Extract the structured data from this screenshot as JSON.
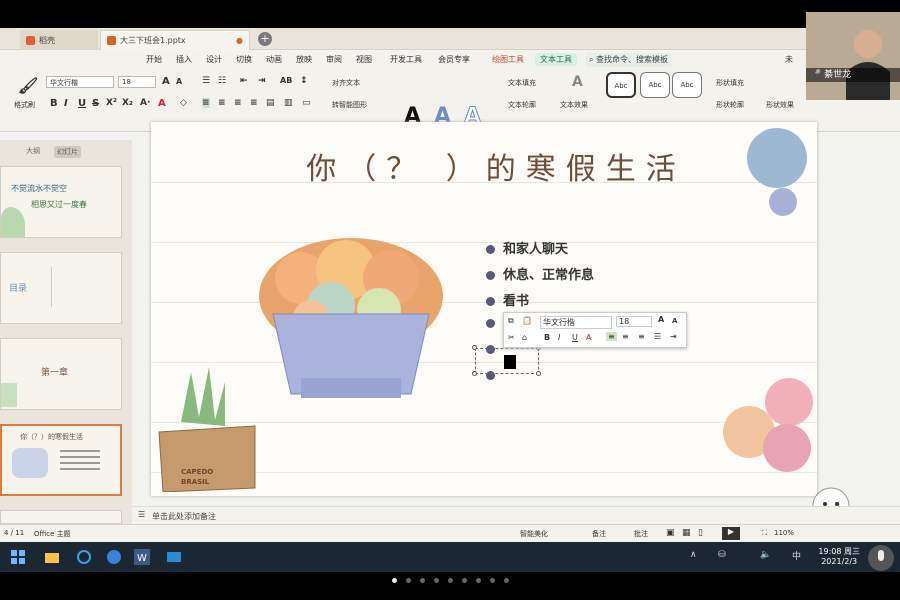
{
  "tabs": {
    "home": "稻壳",
    "doc": "大三下班会1.pptx"
  },
  "menu": [
    "开始",
    "插入",
    "设计",
    "切换",
    "动画",
    "放映",
    "审阅",
    "视图",
    "开发工具",
    "会员专享",
    "绘图工具",
    "文本工具"
  ],
  "menu_search": "查找命令、搜索模板",
  "menu_right": "未",
  "ribbon": {
    "format_painter": "格式刷",
    "font_name": "华文行楷",
    "font_size": "18",
    "align_text": "对齐文本",
    "smartart": "转智能图形",
    "text_fill": "文本填充",
    "text_outline": "文本轮廓",
    "text_effect": "文本效果",
    "shape_fill": "形状填充",
    "shape_outline": "形状轮廓",
    "shape_effect": "形状效果",
    "style_abc": "Abc",
    "bigA": "A"
  },
  "panel": {
    "outline": "大纲",
    "slides": "幻灯片",
    "add": "+"
  },
  "thumbs": [
    {
      "num": "",
      "title": "不觉流水不觉空",
      "sub": "相思又过一度春"
    },
    {
      "num": "",
      "title": "目录",
      "sub": ""
    },
    {
      "num": "",
      "title": "第一章",
      "sub": ""
    },
    {
      "num": "",
      "title": "你（？）的寒假生活",
      "sub": ""
    }
  ],
  "slide": {
    "title": "你（？ ）的寒假生活",
    "bullets": [
      "和家人聊天",
      "休息、正常作息",
      "看书",
      "",
      "",
      ""
    ],
    "pot_label_1": "CAPEDO",
    "pot_label_2": "BRASIL"
  },
  "minitoolbar": {
    "font": "华文行楷",
    "size": "18"
  },
  "notes": "单击此处添加备注",
  "status": {
    "page": "4 / 11",
    "theme": "Office 主题",
    "beautify": "智能美化",
    "notes_btn": "备注",
    "comment_btn": "批注",
    "zoom": "110%"
  },
  "taskbar": {
    "time": "19:08",
    "weekday": "周三",
    "date": "2021/2/3",
    "ime": "中"
  },
  "webcam": {
    "name": "綦世龙"
  },
  "colors": {
    "accent": "#c8462c",
    "bullet": "#56597a",
    "title": "#6e4f37",
    "taskbar": "#1b2733"
  }
}
